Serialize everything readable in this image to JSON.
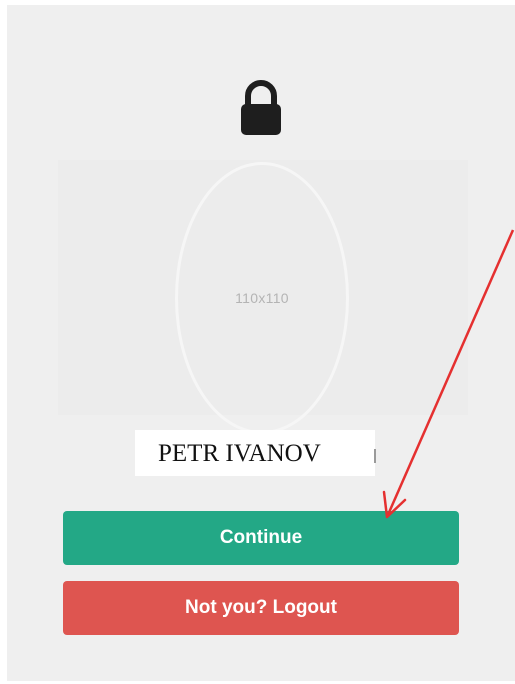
{
  "lock": {
    "icon": "lock-icon",
    "color": "#1e1e1e"
  },
  "avatar": {
    "placeholder": "110x110"
  },
  "user": {
    "name": "PETR IVANOV"
  },
  "buttons": {
    "continue_label": "Continue",
    "continue_color": "#23a886",
    "logout_label": "Not you? Logout",
    "logout_color": "#de5550"
  },
  "annotation": {
    "icon": "red-arrow-annotation",
    "color": "#e53030"
  }
}
